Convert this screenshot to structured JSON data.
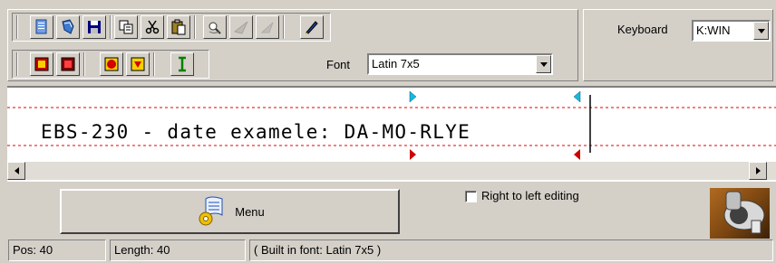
{
  "toolbar": {
    "row1": [
      {
        "name": "new-document-icon",
        "color": "#2a6bd4"
      },
      {
        "name": "open-icon",
        "color": "#1e5fb3"
      },
      {
        "name": "save-icon",
        "color": "#00007f"
      },
      {
        "name": "copy-icon",
        "color": "#000000"
      },
      {
        "name": "cut-icon",
        "color": "#000000"
      },
      {
        "name": "paste-icon",
        "color": "#7f6a00"
      },
      {
        "name": "print-preview-icon",
        "color": "#555555"
      },
      {
        "name": "send-icon",
        "color": "#808080"
      },
      {
        "name": "edit-pen-icon",
        "color": "#1a3fa0"
      }
    ],
    "row2": [
      {
        "name": "print-red-icon",
        "color": "#c00000"
      },
      {
        "name": "print-dark-icon",
        "color": "#800000"
      },
      {
        "name": "star-red-icon",
        "color": "#d00000"
      },
      {
        "name": "arrow-down-red-icon",
        "color": "#d00000"
      },
      {
        "name": "text-cursor-icon",
        "color": "#008000"
      }
    ]
  },
  "font": {
    "label": "Font",
    "value": "Latin 7x5"
  },
  "keyboard": {
    "label": "Keyboard",
    "value": "K:WIN"
  },
  "editor": {
    "text": "EBS-230 - date examele: DA-MO-RLYE",
    "guide_color": "#e00000",
    "marker_top_color": "#18b8e0",
    "marker_bottom_color": "#cc0000"
  },
  "menu_button": {
    "label": "Menu",
    "icon": "menu-scroll-icon"
  },
  "rtl": {
    "label": "Right to left editing",
    "checked": false
  },
  "status": {
    "pos": "Pos: 40",
    "length": "Length: 40",
    "font_info": "( Built in font: Latin 7x5 )"
  }
}
